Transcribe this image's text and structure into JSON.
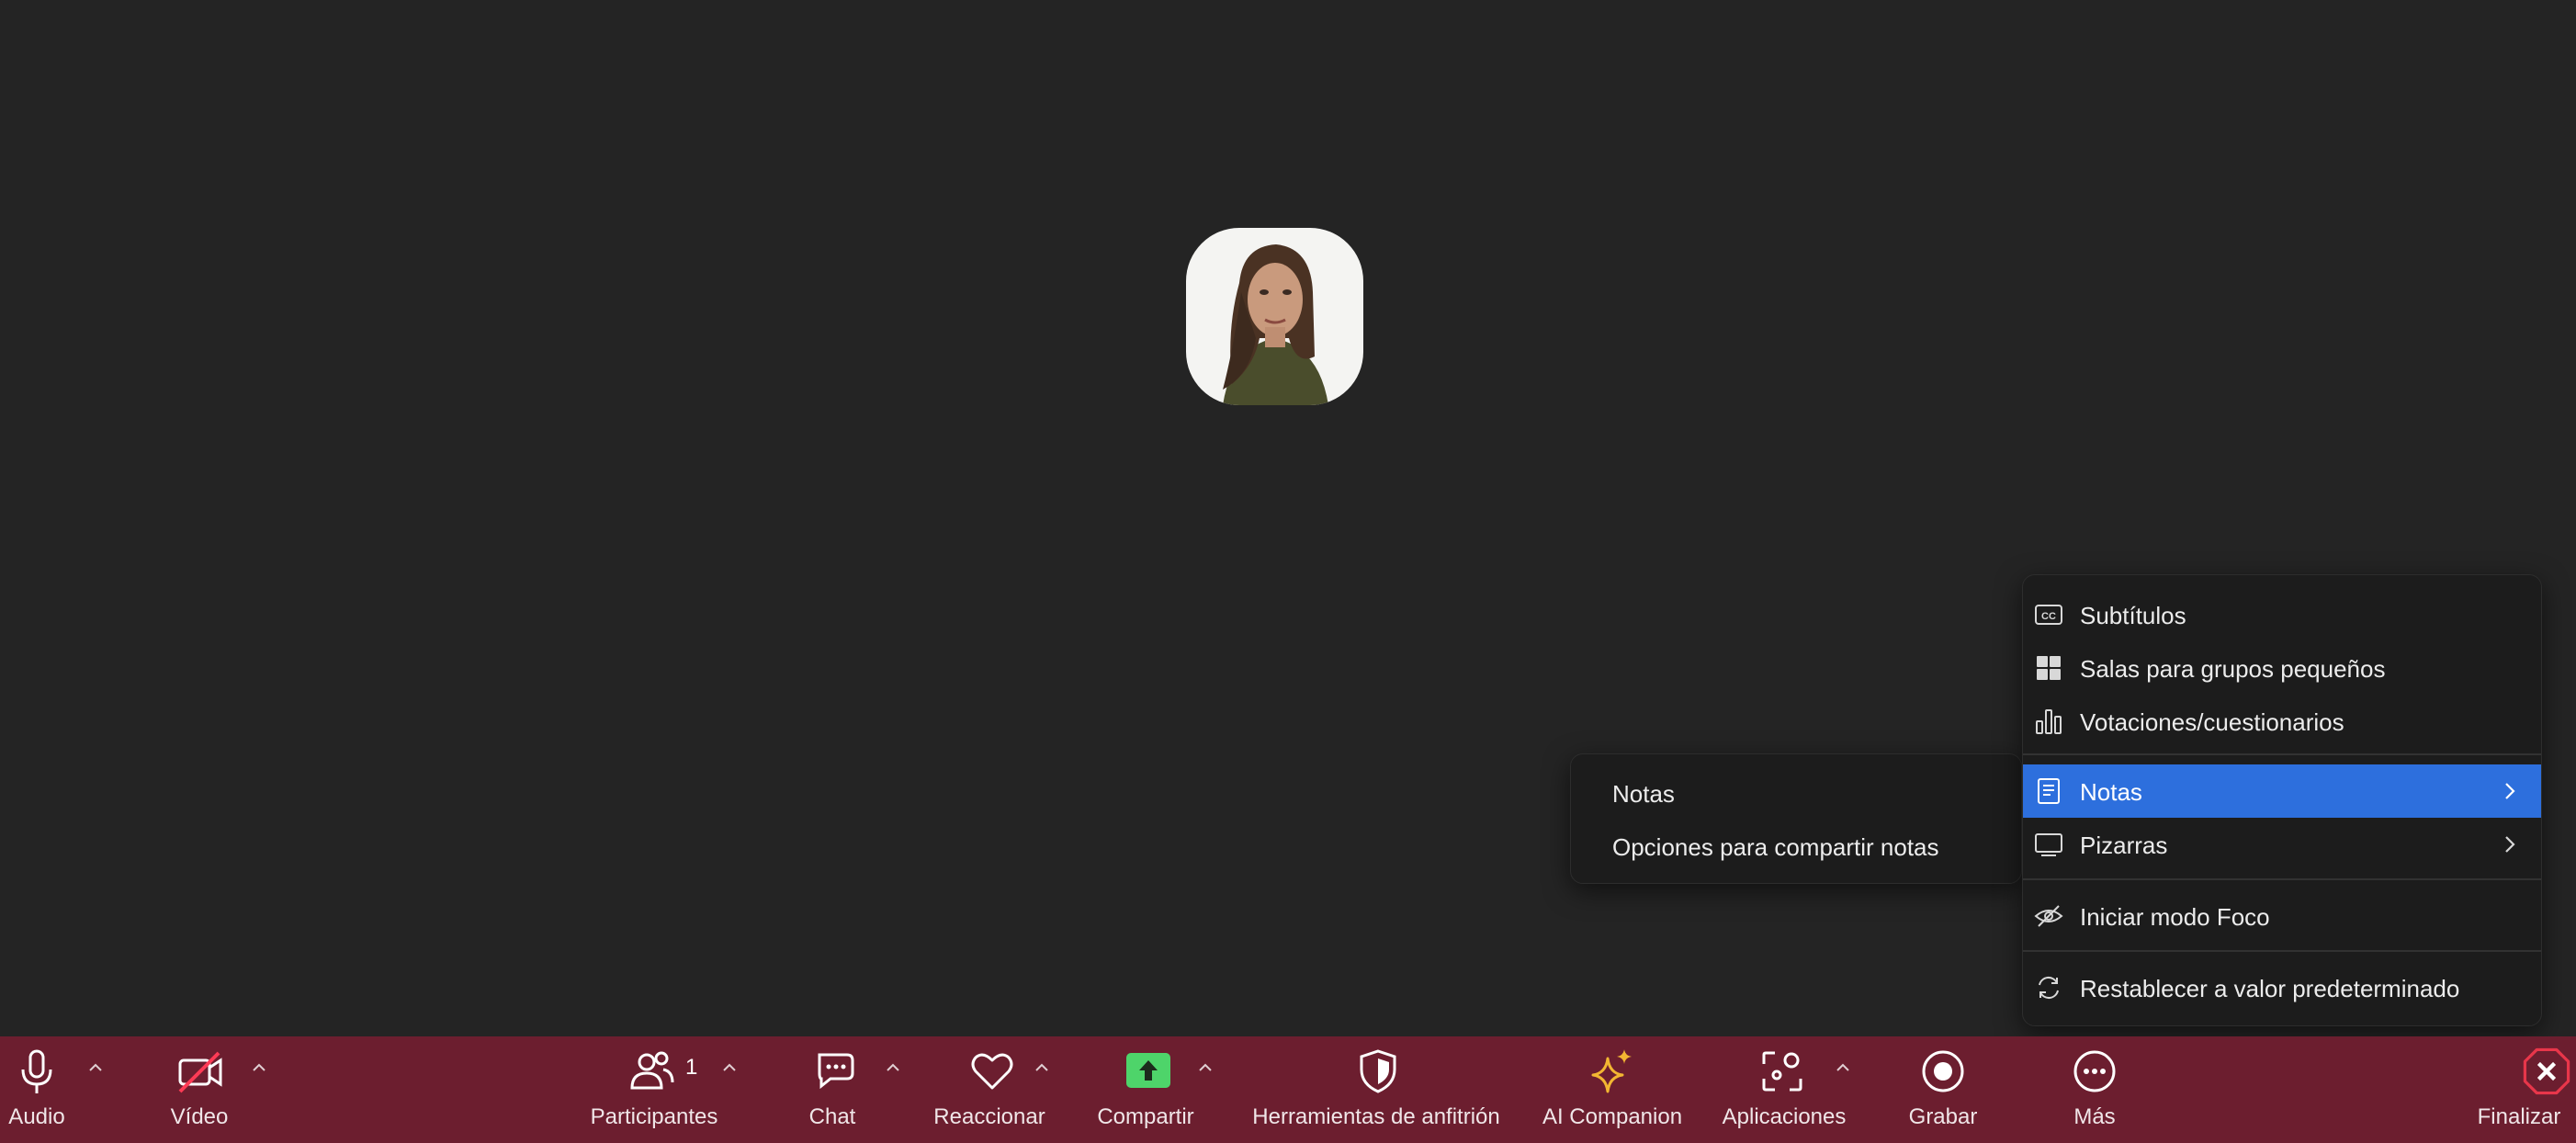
{
  "toolbar": {
    "audio": "Audio",
    "video": "Vídeo",
    "participants": "Participantes",
    "participants_count": "1",
    "chat": "Chat",
    "react": "Reaccionar",
    "share": "Compartir",
    "host_tools": "Herramientas de anfitrión",
    "ai_companion": "AI Companion",
    "apps": "Aplicaciones",
    "record": "Grabar",
    "more": "Más",
    "end": "Finalizar"
  },
  "more_menu": {
    "items": [
      {
        "label": "Subtítulos",
        "icon": "cc-icon"
      },
      {
        "label": "Salas para grupos pequeños",
        "icon": "grid-icon"
      },
      {
        "label": "Votaciones/cuestionarios",
        "icon": "bar-chart-icon"
      },
      {
        "label": "Notas",
        "icon": "notes-icon",
        "selected": true,
        "has_submenu": true
      },
      {
        "label": "Pizarras",
        "icon": "whiteboard-icon",
        "has_submenu": true
      },
      {
        "label": "Iniciar modo Foco",
        "icon": "eye-off-icon"
      },
      {
        "label": "Restablecer a valor predeterminado",
        "icon": "reset-icon"
      }
    ]
  },
  "notes_submenu": {
    "items": [
      "Notas",
      "Opciones para compartir notas"
    ]
  },
  "colors": {
    "toolbar_bg": "#6c1e2f",
    "stage_bg": "#242424",
    "menu_bg": "#1c1c1c",
    "selection": "#2d6fdd",
    "share_green": "#4ed46a",
    "ai_gold": "#f2b632",
    "end_red": "#e8364a"
  }
}
